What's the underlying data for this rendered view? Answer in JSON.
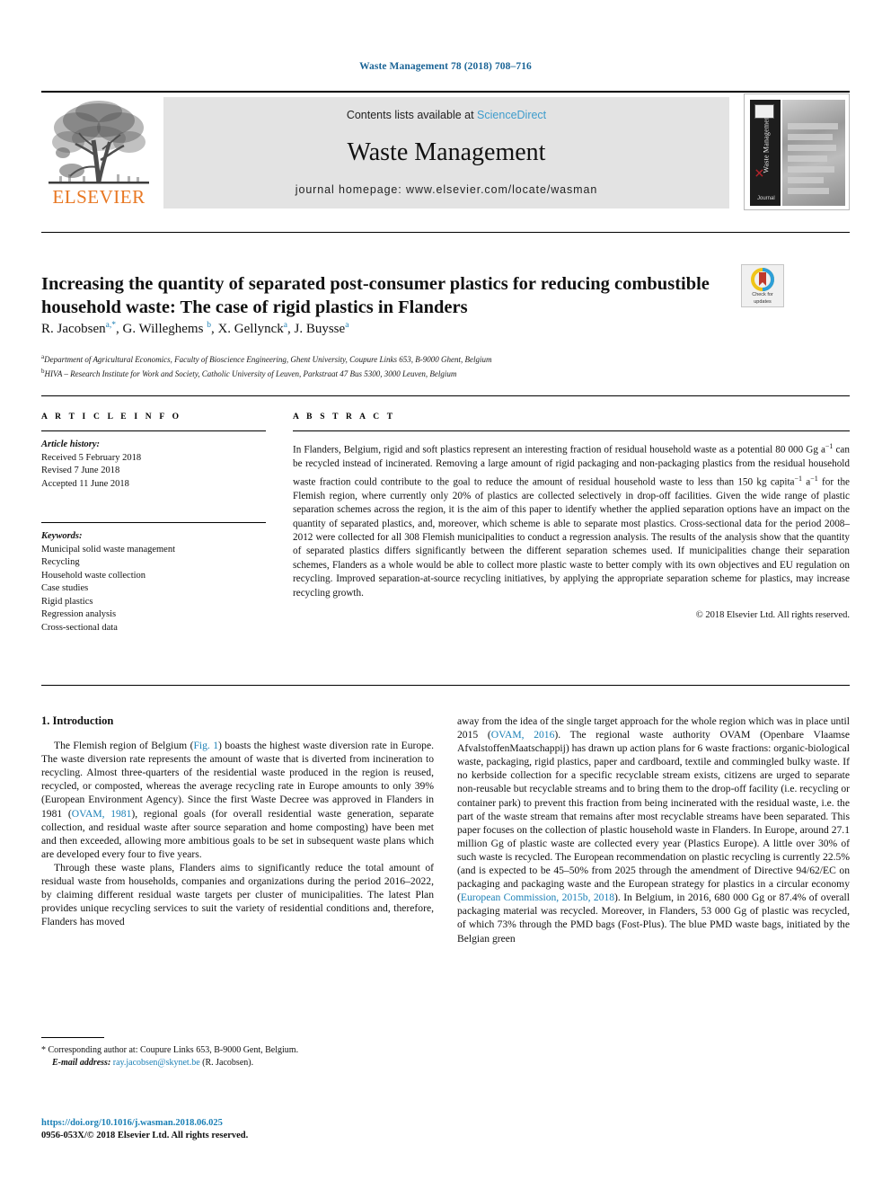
{
  "running_head": "Waste Management 78 (2018) 708–716",
  "masthead": {
    "contents_prefix": "Contents lists available at ",
    "sciencedirect": "ScienceDirect",
    "journal_title": "Waste Management",
    "homepage": "journal homepage: www.elsevier.com/locate/wasman",
    "publisher_name": "ELSEVIER",
    "cover_vertical_text": "Waste Management",
    "cover_footer": "Journal",
    "accent_link_color": "#3e9ccc",
    "publisher_color": "#E87722",
    "band_color": "#e3e3e3"
  },
  "article": {
    "title": "Increasing the quantity of separated post-consumer plastics for reducing combustible household waste: The case of rigid plastics in Flanders",
    "crossmark_label_line1": "Check for",
    "crossmark_label_line2": "updates",
    "authors": [
      {
        "name": "R. Jacobsen",
        "marks": "a,*"
      },
      {
        "name": "G. Willeghems",
        "marks": "b"
      },
      {
        "name": "X. Gellynck",
        "marks": "a"
      },
      {
        "name": "J. Buysse",
        "marks": "a"
      }
    ],
    "affiliations": [
      {
        "mark": "a",
        "text": "Department of Agricultural Economics, Faculty of Bioscience Engineering, Ghent University, Coupure Links 653, B-9000 Ghent, Belgium"
      },
      {
        "mark": "b",
        "text": "HIVA – Research Institute for Work and Society, Catholic University of Leuven, Parkstraat 47 Bus 5300, 3000 Leuven, Belgium"
      }
    ]
  },
  "article_info": {
    "heading": "A R T I C L E   I N F O",
    "history_label": "Article history:",
    "history": [
      "Received 5 February 2018",
      "Revised 7 June 2018",
      "Accepted 11 June 2018"
    ],
    "keywords_label": "Keywords:",
    "keywords": [
      "Municipal solid waste management",
      "Recycling",
      "Household waste collection",
      "Case studies",
      "Rigid plastics",
      "Regression analysis",
      "Cross-sectional data"
    ]
  },
  "abstract": {
    "heading": "A B S T R A C T",
    "paragraph_1": "In Flanders, Belgium, rigid and soft plastics represent an interesting fraction of residual household waste as a potential 80 000 Gg a",
    "sup_1": "−1",
    "paragraph_2": " can be recycled instead of incinerated. Removing a large amount of rigid packaging and non-packaging plastics from the residual household waste fraction could contribute to the goal to reduce the amount of residual household waste to less than 150 kg capita",
    "sup_2": "−1",
    "paragraph_3": " a",
    "sup_3": "−1",
    "paragraph_4": " for the Flemish region, where currently only 20% of plastics are collected selectively in drop-off facilities. Given the wide range of plastic separation schemes across the region, it is the aim of this paper to identify whether the applied separation options have an impact on the quantity of separated plastics, and, moreover, which scheme is able to separate most plastics. Cross-sectional data for the period 2008–2012 were collected for all 308 Flemish municipalities to conduct a regression analysis. The results of the analysis show that the quantity of separated plastics differs significantly between the different separation schemes used. If municipalities change their separation schemes, Flanders as a whole would be able to collect more plastic waste to better comply with its own objectives and EU regulation on recycling. Improved separation-at-source recycling initiatives, by applying the appropriate separation scheme for plastics, may increase recycling growth.",
    "copyright": "© 2018 Elsevier Ltd. All rights reserved."
  },
  "body": {
    "section_heading": "1. Introduction",
    "left_p1_a": "The Flemish region of Belgium (",
    "left_p1_fig": "Fig. 1",
    "left_p1_b": ") boasts the highest waste diversion rate in Europe. The waste diversion rate represents the amount of waste that is diverted from incineration to recycling. Almost three-quarters of the residential waste produced in the region is reused, recycled, or composted, whereas the average recycling rate in Europe amounts to only 39% (European Environment Agency). Since the first Waste Decree was approved in Flanders in 1981 (",
    "left_p1_ref": "OVAM, 1981",
    "left_p1_c": "), regional goals (for overall residential waste generation, separate collection, and residual waste after source separation and home composting) have been met and then exceeded, allowing more ambitious goals to be set in subsequent waste plans which are developed every four to five years.",
    "left_p2": "Through these waste plans, Flanders aims to significantly reduce the total amount of residual waste from households, companies and organizations during the period 2016–2022, by claiming different residual waste targets per cluster of municipalities. The latest Plan provides unique recycling services to suit the variety of residential conditions and, therefore, Flanders has moved",
    "right_p1_a": "away from the idea of the single target approach for the whole region which was in place until 2015 (",
    "right_p1_ref1": "OVAM, 2016",
    "right_p1_b": "). The regional waste authority OVAM (Openbare Vlaamse AfvalstoffenMaatschappij) has drawn up action plans for 6 waste fractions: organic-biological waste, packaging, rigid plastics, paper and cardboard, textile and commingled bulky waste. If no kerbside collection for a specific recyclable stream exists, citizens are urged to separate non-reusable but recyclable streams and to bring them to the drop-off facility (i.e. recycling or container park) to prevent this fraction from being incinerated with the residual waste, i.e. the part of the waste stream that remains after most recyclable streams have been separated. This paper focuses on the collection of plastic household waste in Flanders. In Europe, around 27.1 million Gg of plastic waste are collected every year (Plastics Europe). A little over 30% of such waste is recycled. The European recommendation on plastic recycling is currently 22.5% (and is expected to be 45–50% from 2025 through the amendment of Directive 94/62/EC on packaging and packaging waste and the European strategy for plastics in a circular economy (",
    "right_p1_ref2": "European Commission, 2015b, 2018",
    "right_p1_c": "). In Belgium, in 2016, 680 000 Gg or 87.4% of overall packaging material was recycled. Moreover, in Flanders, 53 000 Gg of plastic was recycled, of which 73% through the PMD bags (Fost-Plus). The blue PMD waste bags, initiated by the Belgian green"
  },
  "footnote": {
    "star": "*",
    "corresponding": "Corresponding author at: Coupure Links 653, B-9000 Gent, Belgium.",
    "email_label": "E-mail address:",
    "email": "ray.jacobsen@skynet.be",
    "email_owner": "(R. Jacobsen)."
  },
  "bottom": {
    "doi": "https://doi.org/10.1016/j.wasman.2018.06.025",
    "issn": "0956-053X/© 2018 Elsevier Ltd. All rights reserved."
  }
}
